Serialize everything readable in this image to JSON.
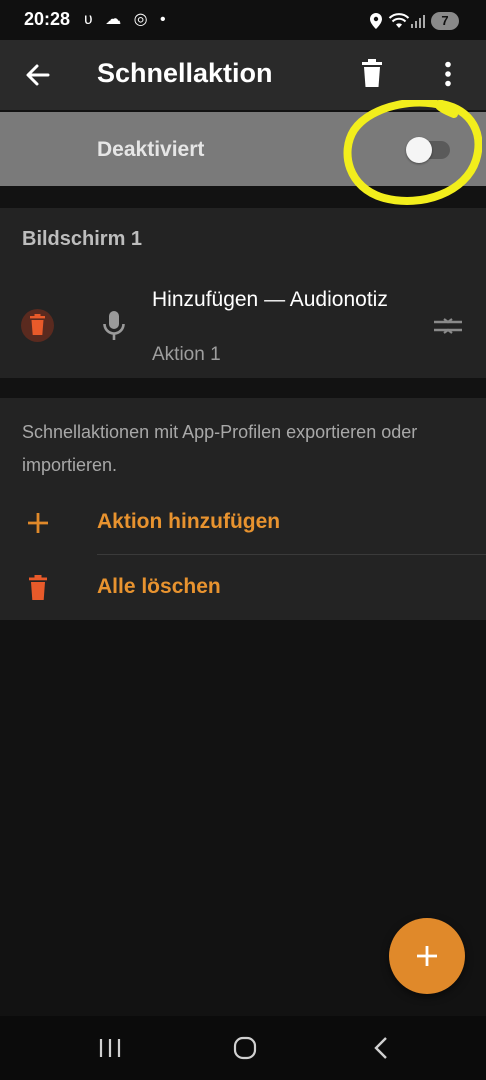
{
  "status_bar": {
    "time": "20:28",
    "left_icons": "ʋ ☁ ◎ •",
    "battery": "7"
  },
  "app_bar": {
    "title": "Schnellaktion",
    "back_icon": "arrow-left-icon",
    "delete_icon": "trash-icon",
    "menu_icon": "more-vert-icon"
  },
  "status_toggle": {
    "label": "Deaktiviert",
    "enabled": false
  },
  "screen_section": {
    "title": "Bildschirm 1",
    "items": [
      {
        "title": "Hinzufügen — Audionotiz",
        "subtitle": "Aktion 1",
        "icon": "microphone-icon"
      }
    ]
  },
  "info_section": {
    "description": "Schnellaktionen mit App-Profilen exportieren oder importieren.",
    "actions": [
      {
        "label": "Aktion hinzufügen",
        "icon": "plus-icon"
      },
      {
        "label": "Alle löschen",
        "icon": "trash-icon"
      }
    ]
  },
  "fab": {
    "icon": "plus-icon"
  },
  "colors": {
    "accent": "#E0892A",
    "danger": "#E85A2A",
    "annotation": "#F2EE1C"
  }
}
